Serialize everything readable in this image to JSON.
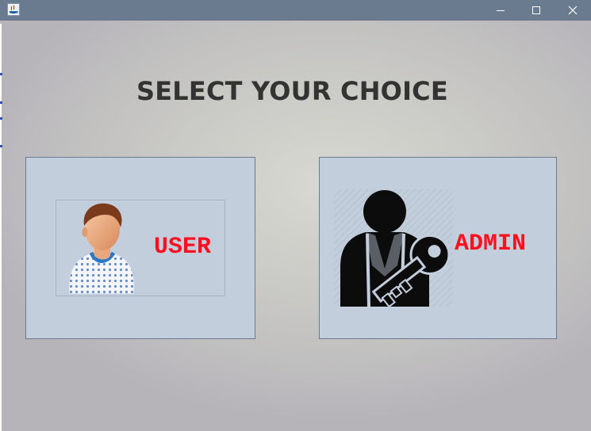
{
  "window": {
    "controls": [
      "minimize",
      "maximize",
      "close"
    ]
  },
  "heading": "SELECT YOUR CHOICE",
  "choices": {
    "user": {
      "label": "USER",
      "label_color": "#ff1020"
    },
    "admin": {
      "label": "ADMIN",
      "label_color": "#ff1020"
    }
  },
  "colors": {
    "titlebar": "#6a7a8f",
    "panel": "#c2cedc",
    "panel_border": "#6c7a90",
    "heading": "#333333"
  }
}
